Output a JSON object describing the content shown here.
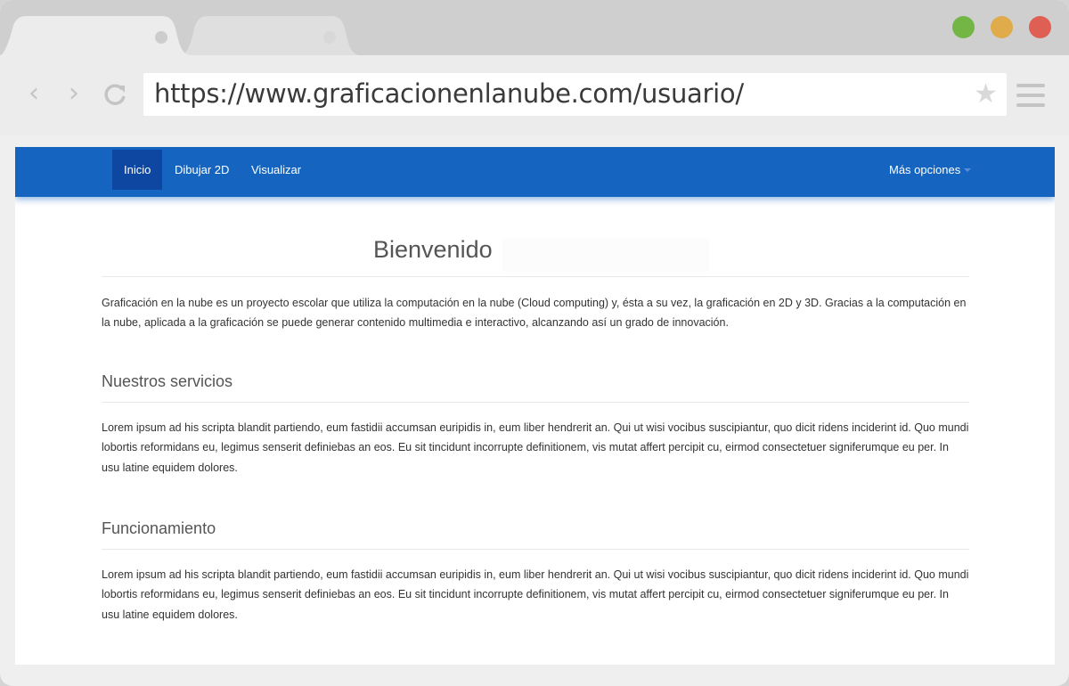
{
  "browser": {
    "tabs": [
      {
        "label": ""
      },
      {
        "label": ""
      }
    ],
    "window_controls": {
      "colors": {
        "green": "#73b646",
        "yellow": "#e0ab4a",
        "red": "#e05f55"
      }
    },
    "toolbar": {
      "back_icon": "back-icon",
      "forward_icon": "forward-icon",
      "reload_icon": "reload-icon",
      "bookmark_icon": "star-icon",
      "menu_icon": "menu-icon"
    },
    "url": "https://www.graficacionenlanube.com/usuario/"
  },
  "navbar": {
    "color": "#1565c0",
    "active_color": "#0d47a1",
    "items": [
      {
        "label": "Inicio",
        "active": true
      },
      {
        "label": "Dibujar 2D",
        "active": false
      },
      {
        "label": "Visualizar",
        "active": false
      }
    ],
    "more": {
      "label": "Más opciones",
      "icon": "caret-down-icon"
    }
  },
  "page": {
    "title": "Bienvenido",
    "intro": "Graficación en la nube es un proyecto escolar que utiliza la computación en la nube (Cloud computing) y, ésta a su vez, la graficación en 2D y 3D. Gracias a la computación en la nube, aplicada a la graficación se puede generar contenido multimedia e interactivo, alcanzando así un grado de innovación.",
    "sections": [
      {
        "heading": "Nuestros servicios",
        "text": "Lorem ipsum ad his scripta blandit partiendo, eum fastidii accumsan euripidis in, eum liber hendrerit an. Qui ut wisi vocibus suscipiantur, quo dicit ridens inciderint id. Quo mundi lobortis reformidans eu, legimus senserit definiebas an eos. Eu sit tincidunt incorrupte definitionem, vis mutat affert percipit cu, eirmod consectetuer signiferumque eu per. In usu latine equidem dolores."
      },
      {
        "heading": "Funcionamiento",
        "text": "Lorem ipsum ad his scripta blandit partiendo, eum fastidii accumsan euripidis in, eum liber hendrerit an. Qui ut wisi vocibus suscipiantur, quo dicit ridens inciderint id. Quo mundi lobortis reformidans eu, legimus senserit definiebas an eos. Eu sit tincidunt incorrupte definitionem, vis mutat affert percipit cu, eirmod consectetuer signiferumque eu per. In usu latine equidem dolores."
      }
    ]
  }
}
